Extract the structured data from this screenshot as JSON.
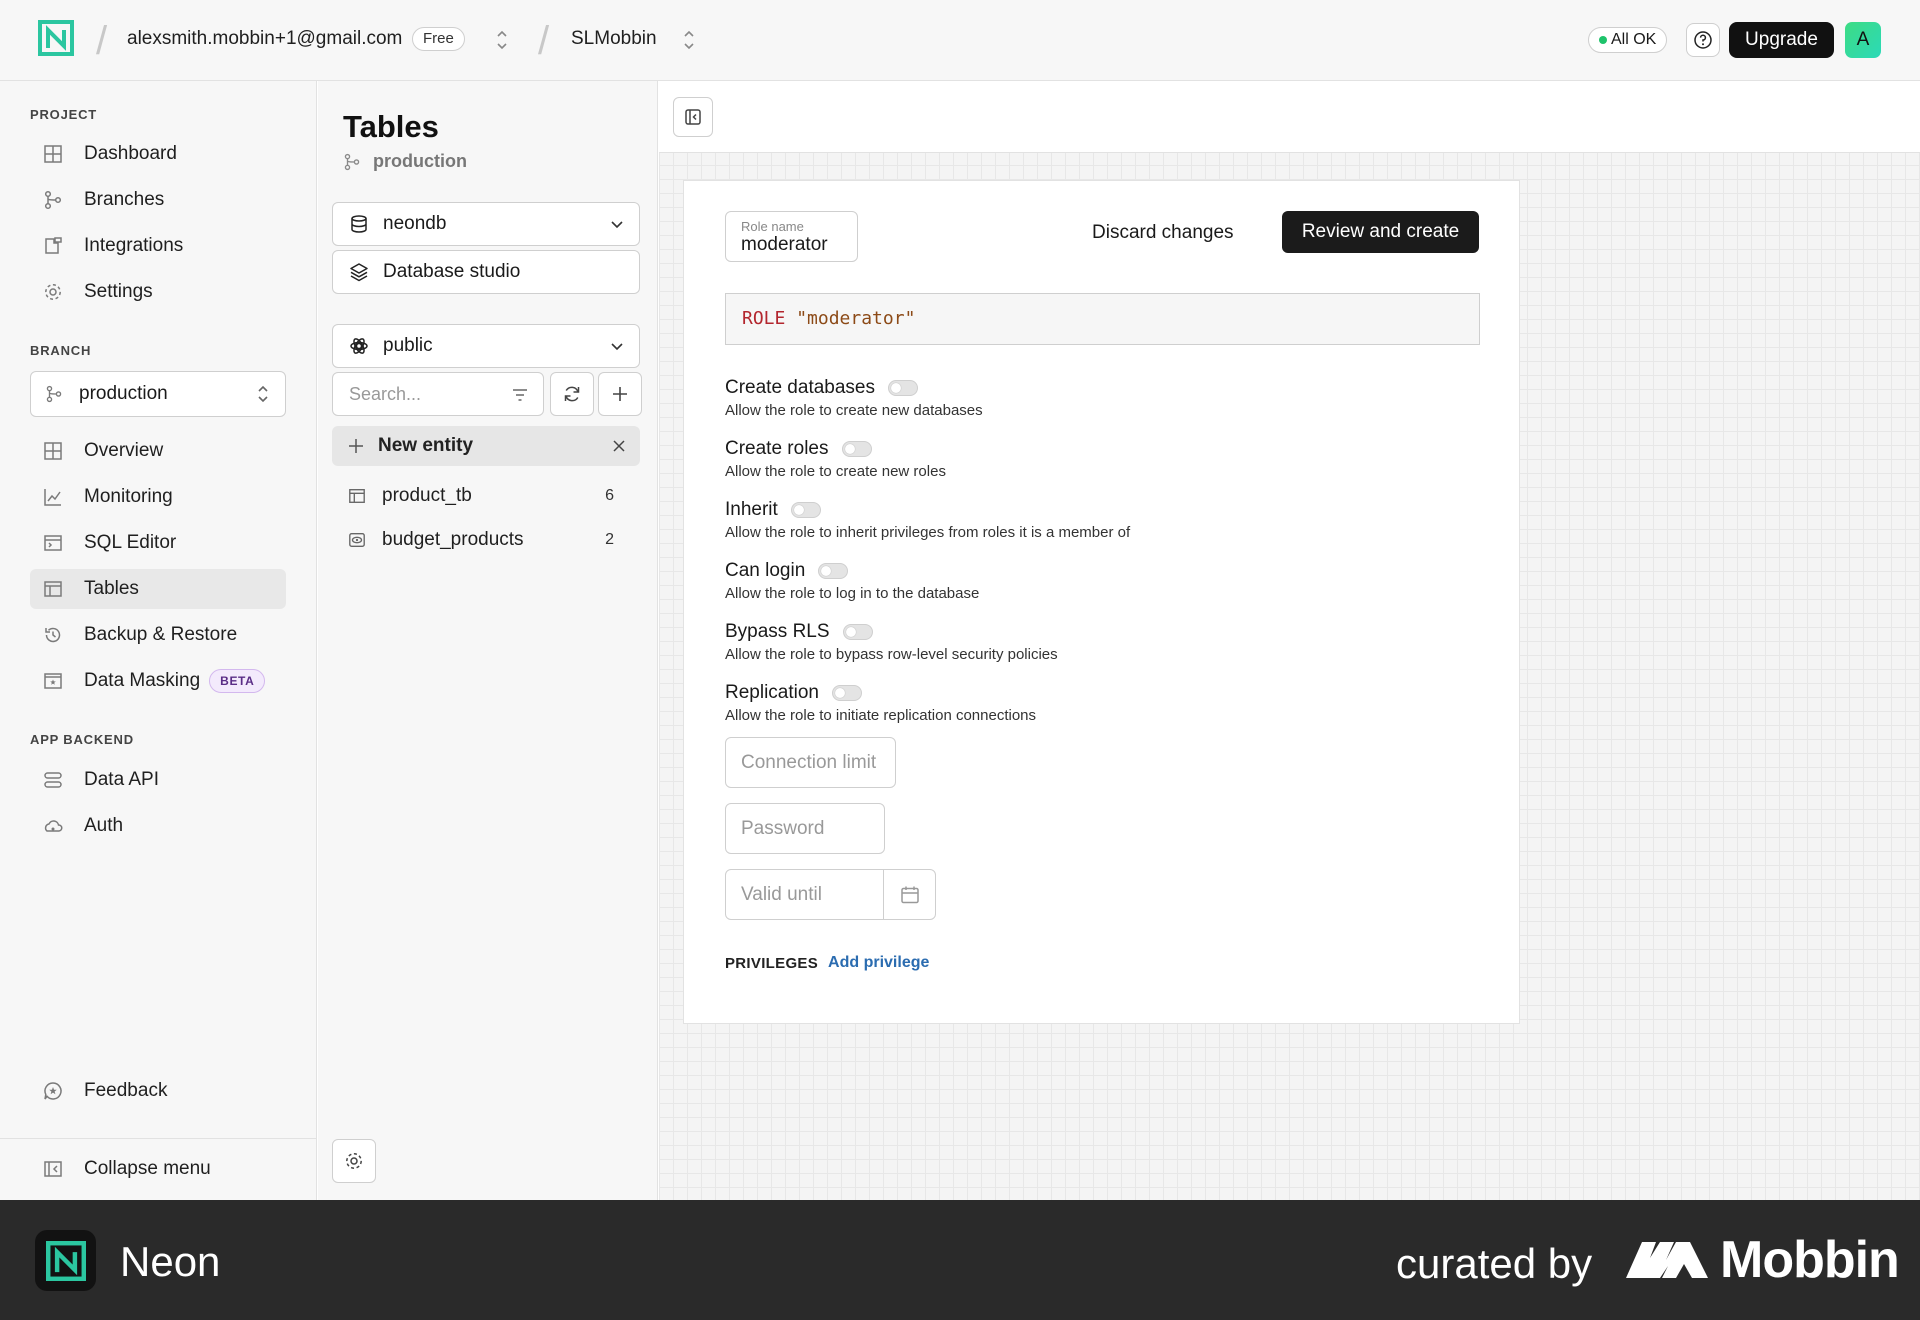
{
  "topbar": {
    "account_email": "alexsmith.mobbin+1@gmail.com",
    "plan_badge": "Free",
    "project_name": "SLMobbin",
    "status": "All OK",
    "upgrade_label": "Upgrade",
    "avatar_letter": "A"
  },
  "sidebar": {
    "project_label": "PROJECT",
    "project_items": [
      {
        "label": "Dashboard",
        "icon": "dashboard-icon"
      },
      {
        "label": "Branches",
        "icon": "branches-icon"
      },
      {
        "label": "Integrations",
        "icon": "integrations-icon"
      },
      {
        "label": "Settings",
        "icon": "gear-icon"
      }
    ],
    "branch_label": "BRANCH",
    "branch_selected": "production",
    "branch_items": [
      {
        "label": "Overview",
        "icon": "overview-icon"
      },
      {
        "label": "Monitoring",
        "icon": "chart-icon"
      },
      {
        "label": "SQL Editor",
        "icon": "terminal-icon"
      },
      {
        "label": "Tables",
        "icon": "table-icon",
        "active": true
      },
      {
        "label": "Backup & Restore",
        "icon": "history-icon"
      },
      {
        "label": "Data Masking",
        "icon": "mask-icon",
        "badge": "BETA"
      }
    ],
    "app_backend_label": "APP BACKEND",
    "app_backend_items": [
      {
        "label": "Data API",
        "icon": "api-icon"
      },
      {
        "label": "Auth",
        "icon": "auth-icon"
      }
    ],
    "feedback_label": "Feedback",
    "collapse_label": "Collapse menu"
  },
  "tables_panel": {
    "title": "Tables",
    "branch": "production",
    "database": "neondb",
    "studio_label": "Database studio",
    "schema": "public",
    "search_placeholder": "Search...",
    "new_entity_label": "New entity",
    "items": [
      {
        "name": "product_tb",
        "count": "6",
        "icon": "table-icon"
      },
      {
        "name": "budget_products",
        "count": "2",
        "icon": "view-icon"
      }
    ]
  },
  "role_form": {
    "role_name_label": "Role name",
    "role_name_value": "moderator",
    "discard_label": "Discard changes",
    "review_label": "Review and create",
    "code_keyword": "ROLE",
    "code_string": "\"moderator\"",
    "permissions": [
      {
        "title": "Create databases",
        "desc": "Allow the role to create new databases",
        "enabled": false
      },
      {
        "title": "Create roles",
        "desc": "Allow the role to create new roles",
        "enabled": false
      },
      {
        "title": "Inherit",
        "desc": "Allow the role to inherit privileges from roles it is a member of",
        "enabled": false
      },
      {
        "title": "Can login",
        "desc": "Allow the role to log in to the database",
        "enabled": false
      },
      {
        "title": "Bypass RLS",
        "desc": "Allow the role to bypass row-level security policies",
        "enabled": false
      },
      {
        "title": "Replication",
        "desc": "Allow the role to initiate replication connections",
        "enabled": false
      }
    ],
    "connection_limit_placeholder": "Connection limit",
    "password_placeholder": "Password",
    "valid_until_placeholder": "Valid until",
    "privileges_label": "PRIVILEGES",
    "add_privilege_label": "Add privilege"
  },
  "footer": {
    "app_name": "Neon",
    "curated_by": "curated by",
    "brand": "Mobbin"
  },
  "colors": {
    "accent_green": "#1ec36b",
    "primary_button": "#1b1b1b",
    "link_blue": "#2b6cb0",
    "code_keyword": "#b3262e",
    "code_string": "#8c4a17"
  }
}
